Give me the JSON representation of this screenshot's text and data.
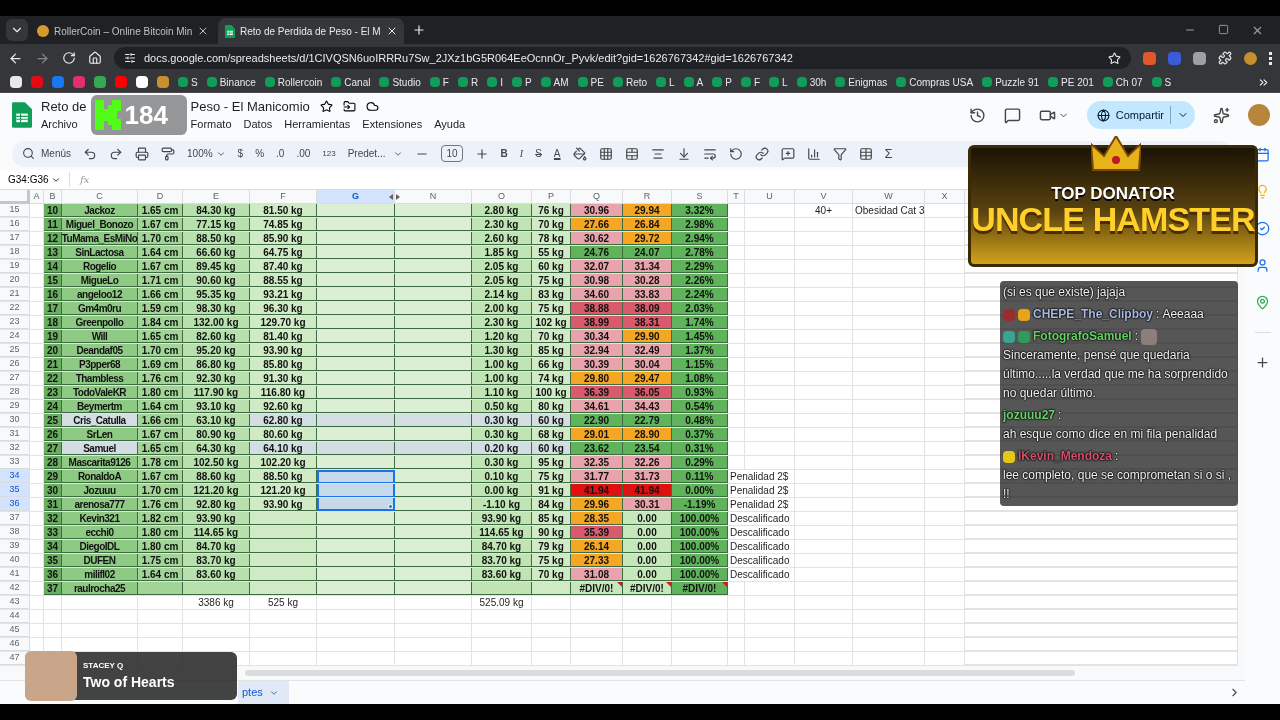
{
  "browser": {
    "tabs": [
      {
        "title": "RollerCoin – Online Bitcoin Min",
        "selected": false
      },
      {
        "title": "Reto de Perdida de Peso - El M",
        "selected": true
      }
    ],
    "url": "docs.google.com/spreadsheets/d/1CIVQSN6uoIRRRu7Sw_2JXz1bG5R064EeOcnnOr_Pyvk/edit?gid=1626767342#gid=1626767342",
    "bookmarks": [
      "S",
      "Binance",
      "Rollercoin",
      "Canal",
      "Studio",
      "F",
      "R",
      "I",
      "P",
      "AM",
      "PE",
      "Reto",
      "L",
      "A",
      "P",
      "F",
      "L",
      "30h",
      "Enigmas",
      "Compras USA",
      "Puzzle 91",
      "PE 201",
      "Ch 07",
      "S"
    ]
  },
  "sheets": {
    "title_parts": [
      "Reto de",
      "Peso - El Manicomio"
    ],
    "menu_left": [
      "Archivo"
    ],
    "menu": [
      "Formato",
      "Datos",
      "Herramientas",
      "Extensiones",
      "Ayuda"
    ],
    "share": "Compartir",
    "toolbar": {
      "search": "Menús",
      "zoom": "100%",
      "currency": "$",
      "percent": "%",
      "dec_less": ".0",
      "dec_more": ".00",
      "number_format": "123",
      "font": "Predet...",
      "font_size": "10",
      "bold": "B",
      "italic": "I",
      "strike": "S",
      "text_color": "A",
      "functions": "Σ"
    },
    "name_box": "G34:G36",
    "fx": "fx",
    "columns": [
      {
        "label": "A",
        "selected": false
      },
      {
        "label": "B",
        "selected": false
      },
      {
        "label": "C",
        "selected": false
      },
      {
        "label": "D",
        "selected": false
      },
      {
        "label": "E",
        "selected": false
      },
      {
        "label": "F",
        "selected": false
      },
      {
        "label": "G",
        "selected": true
      },
      {
        "label": "N",
        "selected": false
      },
      {
        "label": "O",
        "selected": false
      },
      {
        "label": "P",
        "selected": false
      },
      {
        "label": "Q",
        "selected": false
      },
      {
        "label": "R",
        "selected": false
      },
      {
        "label": "S",
        "selected": false
      },
      {
        "label": "T",
        "selected": false
      },
      {
        "label": "U",
        "selected": false
      },
      {
        "label": "V",
        "selected": false
      },
      {
        "label": "W",
        "selected": false
      },
      {
        "label": "X",
        "selected": false
      }
    ],
    "rows": [
      {
        "num": "15",
        "kind": "entry",
        "selected": false,
        "highlighted": false,
        "cells": {
          "B": "10",
          "C": "Jackoz",
          "D": "1.65 cm",
          "E": "84.30 kg",
          "F": "81.50 kg",
          "O": "2.80 kg",
          "P": "76 kg",
          "Q": {
            "text": "30.96",
            "color": "#e8a3ad"
          },
          "R": {
            "text": "29.94",
            "color": "#f5a623"
          },
          "S": {
            "text": "3.32%",
            "color": "#5fb35a"
          },
          "V": "40+",
          "W": "Obesidad Cat 3"
        }
      },
      {
        "num": "16",
        "kind": "entry",
        "selected": false,
        "highlighted": false,
        "cells": {
          "B": "11",
          "C": "Miguel_Bonozo",
          "D": "1.67 cm",
          "E": "77.15 kg",
          "F": "74.85 kg",
          "O": "2.30 kg",
          "P": "70 kg",
          "Q": {
            "text": "27.66",
            "color": "#f5a623"
          },
          "R": {
            "text": "26.84",
            "color": "#f5a623"
          },
          "S": {
            "text": "2.98%",
            "color": "#5fb35a"
          }
        }
      },
      {
        "num": "17",
        "kind": "entry",
        "selected": false,
        "highlighted": false,
        "cells": {
          "B": "12",
          "C": "TuMama_EsMiNo",
          "D": "1.70 cm",
          "E": "88.50 kg",
          "F": "85.90 kg",
          "O": "2.60 kg",
          "P": "78 kg",
          "Q": {
            "text": "30.62",
            "color": "#e8a3ad"
          },
          "R": {
            "text": "29.72",
            "color": "#f5a623"
          },
          "S": {
            "text": "2.94%",
            "color": "#5fb35a"
          }
        }
      },
      {
        "num": "18",
        "kind": "entry",
        "selected": false,
        "highlighted": false,
        "cells": {
          "B": "13",
          "C": "SinLactosa",
          "D": "1.64 cm",
          "E": "66.60 kg",
          "F": "64.75 kg",
          "O": "1.85 kg",
          "P": "55 kg",
          "Q": {
            "text": "24.76",
            "color": "#5fb35a"
          },
          "R": {
            "text": "24.07",
            "color": "#5fb35a"
          },
          "S": {
            "text": "2.78%",
            "color": "#5fb35a"
          }
        }
      },
      {
        "num": "19",
        "kind": "entry",
        "selected": false,
        "highlighted": false,
        "cells": {
          "B": "14",
          "C": "Rogelio",
          "D": "1.67 cm",
          "E": "89.45 kg",
          "F": "87.40 kg",
          "O": "2.05 kg",
          "P": "60 kg",
          "Q": {
            "text": "32.07",
            "color": "#e8a3ad"
          },
          "R": {
            "text": "31.34",
            "color": "#e8a3ad"
          },
          "S": {
            "text": "2.29%",
            "color": "#5fb35a"
          }
        }
      },
      {
        "num": "20",
        "kind": "entry",
        "selected": false,
        "highlighted": false,
        "cells": {
          "B": "15",
          "C": "MigueLo",
          "D": "1.71 cm",
          "E": "90.60 kg",
          "F": "88.55 kg",
          "O": "2.05 kg",
          "P": "75 kg",
          "Q": {
            "text": "30.98",
            "color": "#e8a3ad"
          },
          "R": {
            "text": "30.28",
            "color": "#e8a3ad"
          },
          "S": {
            "text": "2.26%",
            "color": "#5fb35a"
          }
        }
      },
      {
        "num": "21",
        "kind": "entry",
        "selected": false,
        "highlighted": false,
        "cells": {
          "B": "16",
          "C": "angeloo12",
          "D": "1.66 cm",
          "E": "95.35 kg",
          "F": "93.21 kg",
          "O": "2.14 kg",
          "P": "83 kg",
          "Q": {
            "text": "34.60",
            "color": "#e8a3ad"
          },
          "R": {
            "text": "33.83",
            "color": "#e8a3ad"
          },
          "S": {
            "text": "2.24%",
            "color": "#5fb35a"
          }
        }
      },
      {
        "num": "22",
        "kind": "entry",
        "selected": false,
        "highlighted": false,
        "cells": {
          "B": "17",
          "C": "Gm4m0ru",
          "D": "1.59 cm",
          "E": "98.30 kg",
          "F": "96.30 kg",
          "O": "2.00 kg",
          "P": "75 kg",
          "Q": {
            "text": "38.88",
            "color": "#d85a6c"
          },
          "R": {
            "text": "38.09",
            "color": "#d85a6c"
          },
          "S": {
            "text": "2.03%",
            "color": "#5fb35a"
          }
        }
      },
      {
        "num": "23",
        "kind": "entry",
        "selected": false,
        "highlighted": false,
        "cells": {
          "B": "18",
          "C": "Greenpollo",
          "D": "1.84 cm",
          "E": "132.00 kg",
          "F": "129.70 kg",
          "O": "2.30 kg",
          "P": "102 kg",
          "Q": {
            "text": "38.99",
            "color": "#d85a6c"
          },
          "R": {
            "text": "38.31",
            "color": "#d85a6c"
          },
          "S": {
            "text": "1.74%",
            "color": "#5fb35a"
          }
        }
      },
      {
        "num": "24",
        "kind": "entry",
        "selected": false,
        "highlighted": false,
        "cells": {
          "B": "19",
          "C": "Will",
          "D": "1.65 cm",
          "E": "82.60 kg",
          "F": "81.40 kg",
          "O": "1.20 kg",
          "P": "70 kg",
          "Q": {
            "text": "30.34",
            "color": "#e8a3ad"
          },
          "R": {
            "text": "29.90",
            "color": "#f5a623"
          },
          "S": {
            "text": "1.45%",
            "color": "#5fb35a"
          }
        }
      },
      {
        "num": "25",
        "kind": "entry",
        "selected": false,
        "highlighted": false,
        "cells": {
          "B": "20",
          "C": "Deandaf05",
          "D": "1.70 cm",
          "E": "95.20 kg",
          "F": "93.90 kg",
          "O": "1.30 kg",
          "P": "85 kg",
          "Q": {
            "text": "32.94",
            "color": "#e8a3ad"
          },
          "R": {
            "text": "32.49",
            "color": "#e8a3ad"
          },
          "S": {
            "text": "1.37%",
            "color": "#5fb35a"
          }
        }
      },
      {
        "num": "26",
        "kind": "entry",
        "selected": false,
        "highlighted": false,
        "cells": {
          "B": "21",
          "C": "P3pper68",
          "D": "1.69 cm",
          "E": "86.80 kg",
          "F": "85.80 kg",
          "O": "1.00 kg",
          "P": "66 kg",
          "Q": {
            "text": "30.39",
            "color": "#e8a3ad"
          },
          "R": {
            "text": "30.04",
            "color": "#e8a3ad"
          },
          "S": {
            "text": "1.15%",
            "color": "#5fb35a"
          }
        }
      },
      {
        "num": "27",
        "kind": "entry",
        "selected": false,
        "highlighted": false,
        "cells": {
          "B": "22",
          "C": "Thambless",
          "D": "1.76 cm",
          "E": "92.30 kg",
          "F": "91.30 kg",
          "O": "1.00 kg",
          "P": "74 kg",
          "Q": {
            "text": "29.80",
            "color": "#f5a623"
          },
          "R": {
            "text": "29.47",
            "color": "#f5a623"
          },
          "S": {
            "text": "1.08%",
            "color": "#5fb35a"
          }
        }
      },
      {
        "num": "28",
        "kind": "entry",
        "selected": false,
        "highlighted": false,
        "cells": {
          "B": "23",
          "C": "TodoValeKR",
          "D": "1.80 cm",
          "E": "117.90 kg",
          "F": "116.80 kg",
          "O": "1.10 kg",
          "P": "100 kg",
          "Q": {
            "text": "36.39",
            "color": "#d85a6c"
          },
          "R": {
            "text": "36.05",
            "color": "#d85a6c"
          },
          "S": {
            "text": "0.93%",
            "color": "#5fb35a"
          }
        }
      },
      {
        "num": "29",
        "kind": "entry",
        "selected": false,
        "highlighted": false,
        "cells": {
          "B": "24",
          "C": "Beymertm",
          "D": "1.64 cm",
          "E": "93.10 kg",
          "F": "92.60 kg",
          "O": "0.50 kg",
          "P": "80 kg",
          "Q": {
            "text": "34.61",
            "color": "#e8a3ad"
          },
          "R": {
            "text": "34.43",
            "color": "#e8a3ad"
          },
          "S": {
            "text": "0.54%",
            "color": "#5fb35a"
          }
        }
      },
      {
        "num": "30",
        "kind": "entry",
        "selected": false,
        "highlighted": true,
        "cells": {
          "B": "25",
          "C": "Cris_Catulla",
          "D": "1.66 cm",
          "E": "63.10 kg",
          "F": "62.80 kg",
          "O": "0.30 kg",
          "P": "60 kg",
          "Q": {
            "text": "22.90",
            "color": "#5fb35a"
          },
          "R": {
            "text": "22.79",
            "color": "#5fb35a"
          },
          "S": {
            "text": "0.48%",
            "color": "#5fb35a"
          }
        }
      },
      {
        "num": "31",
        "kind": "entry",
        "selected": false,
        "highlighted": false,
        "cells": {
          "B": "26",
          "C": "SrLen",
          "D": "1.67 cm",
          "E": "80.90 kg",
          "F": "80.60 kg",
          "O": "0.30 kg",
          "P": "68 kg",
          "Q": {
            "text": "29.01",
            "color": "#f5a623"
          },
          "R": {
            "text": "28.90",
            "color": "#f5a623"
          },
          "S": {
            "text": "0.37%",
            "color": "#5fb35a"
          }
        }
      },
      {
        "num": "32",
        "kind": "entry",
        "selected": false,
        "highlighted": true,
        "cells": {
          "B": "27",
          "C": "Samuel",
          "D": "1.65 cm",
          "E": "64.30 kg",
          "F": "64.10 kg",
          "O": "0.20 kg",
          "P": "60 kg",
          "Q": {
            "text": "23.62",
            "color": "#5fb35a"
          },
          "R": {
            "text": "23.54",
            "color": "#5fb35a"
          },
          "S": {
            "text": "0.31%",
            "color": "#5fb35a"
          }
        }
      },
      {
        "num": "33",
        "kind": "entry",
        "selected": false,
        "highlighted": false,
        "cells": {
          "B": "28",
          "C": "Mascarita9126",
          "D": "1.78 cm",
          "E": "102.50 kg",
          "F": "102.20 kg",
          "O": "0.30 kg",
          "P": "95 kg",
          "Q": {
            "text": "32.35",
            "color": "#e8a3ad"
          },
          "R": {
            "text": "32.26",
            "color": "#e8a3ad"
          },
          "S": {
            "text": "0.29%",
            "color": "#5fb35a"
          }
        }
      },
      {
        "num": "34",
        "kind": "entry",
        "selected": true,
        "highlighted": false,
        "cells": {
          "B": "29",
          "C": "RonaldoA",
          "D": "1.67 cm",
          "E": "88.60 kg",
          "F": "88.50 kg",
          "O": "0.10 kg",
          "P": "75 kg",
          "Q": {
            "text": "31.77",
            "color": "#e8a3ad"
          },
          "R": {
            "text": "31.73",
            "color": "#e8a3ad"
          },
          "S": {
            "text": "0.11%",
            "color": "#5fb35a"
          },
          "T": "Penalidad 2$"
        }
      },
      {
        "num": "35",
        "kind": "entry",
        "selected": true,
        "highlighted": false,
        "cells": {
          "B": "30",
          "C": "Jozuuu",
          "D": "1.70 cm",
          "E": "121.20 kg",
          "F": "121.20 kg",
          "O": "0.00 kg",
          "P": "91 kg",
          "Q": {
            "text": "41.94",
            "color": "#e01010"
          },
          "R": {
            "text": "41.94",
            "color": "#e01010"
          },
          "S": {
            "text": "0.00%",
            "color": "#5fb35a"
          },
          "T": "Penalidad 2$"
        }
      },
      {
        "num": "36",
        "kind": "entry",
        "selected": true,
        "highlighted": false,
        "cells": {
          "B": "31",
          "C": "arenosa777",
          "D": "1.76 cm",
          "E": "92.80 kg",
          "F": "93.90 kg",
          "O": "-1.10 kg",
          "P": "84 kg",
          "Q": {
            "text": "29.96",
            "color": "#f5a623"
          },
          "R": {
            "text": "30.31",
            "color": "#e8a3ad"
          },
          "S": {
            "text": "-1.19%",
            "color": "#5fb35a"
          },
          "T": "Penalidad 2$"
        }
      },
      {
        "num": "37",
        "kind": "entry",
        "selected": false,
        "highlighted": false,
        "cells": {
          "B": "32",
          "C": "Kevin321",
          "D": "1.82 cm",
          "E": "93.90 kg",
          "O": "93.90 kg",
          "P": "85 kg",
          "Q": {
            "text": "28.35",
            "color": "#f5a623"
          },
          "R": {
            "text": "0.00",
            "color": "#c6e6bc"
          },
          "S": {
            "text": "100.00%",
            "color": "#5fb35a"
          },
          "T": "Descalificado"
        }
      },
      {
        "num": "38",
        "kind": "entry",
        "selected": false,
        "highlighted": false,
        "cells": {
          "B": "33",
          "C": "ecchi0",
          "D": "1.80 cm",
          "E": "114.65 kg",
          "O": "114.65 kg",
          "P": "90 kg",
          "Q": {
            "text": "35.39",
            "color": "#d85a6c"
          },
          "R": {
            "text": "0.00",
            "color": "#c6e6bc"
          },
          "S": {
            "text": "100.00%",
            "color": "#5fb35a"
          },
          "T": "Descalificado"
        }
      },
      {
        "num": "39",
        "kind": "entry",
        "selected": false,
        "highlighted": false,
        "cells": {
          "B": "34",
          "C": "DiegoIDL",
          "D": "1.80 cm",
          "E": "84.70 kg",
          "O": "84.70 kg",
          "P": "79 kg",
          "Q": {
            "text": "26.14",
            "color": "#f5a623"
          },
          "R": {
            "text": "0.00",
            "color": "#c6e6bc"
          },
          "S": {
            "text": "100.00%",
            "color": "#5fb35a"
          },
          "T": "Descalificado"
        }
      },
      {
        "num": "40",
        "kind": "entry",
        "selected": false,
        "highlighted": false,
        "cells": {
          "B": "35",
          "C": "DUFEN",
          "D": "1.75 cm",
          "E": "83.70 kg",
          "O": "83.70 kg",
          "P": "75 kg",
          "Q": {
            "text": "27.33",
            "color": "#f5a623"
          },
          "R": {
            "text": "0.00",
            "color": "#c6e6bc"
          },
          "S": {
            "text": "100.00%",
            "color": "#5fb35a"
          },
          "T": "Descalificado"
        }
      },
      {
        "num": "41",
        "kind": "entry",
        "selected": false,
        "highlighted": false,
        "cells": {
          "B": "36",
          "C": "milifl02",
          "D": "1.64 cm",
          "E": "83.60 kg",
          "O": "83.60 kg",
          "P": "70 kg",
          "Q": {
            "text": "31.08",
            "color": "#e8a3ad"
          },
          "R": {
            "text": "0.00",
            "color": "#c6e6bc"
          },
          "S": {
            "text": "100.00%",
            "color": "#5fb35a"
          },
          "T": "Descalificado"
        }
      },
      {
        "num": "42",
        "kind": "entry",
        "selected": false,
        "highlighted": false,
        "cells": {
          "B": "37",
          "C": "raulrocha25",
          "Q": {
            "text": "#DIV/0!",
            "color": "#c6e6bc",
            "error": true
          },
          "R": {
            "text": "#DIV/0!",
            "color": "#c6e6bc",
            "error": true
          },
          "S": {
            "text": "#DIV/0!",
            "color": "#5fb35a",
            "error": true
          }
        }
      },
      {
        "num": "43",
        "kind": "total",
        "selected": false,
        "highlighted": false,
        "cells": {
          "E": "3386 kg",
          "F": "525 kg",
          "O": "525.09 kg"
        }
      },
      {
        "num": "44",
        "kind": "blank",
        "selected": false,
        "highlighted": false,
        "cells": {}
      },
      {
        "num": "45",
        "kind": "blank",
        "selected": false,
        "highlighted": false,
        "cells": {}
      },
      {
        "num": "46",
        "kind": "blank",
        "selected": false,
        "highlighted": false,
        "cells": {}
      },
      {
        "num": "47",
        "kind": "blank",
        "selected": false,
        "highlighted": false,
        "cells": {}
      }
    ],
    "sheet_tab": "ptes"
  },
  "overlays": {
    "counter": "184",
    "donator": {
      "line1": "TOP DONATOR",
      "line2": "UNCLE HAMSTER"
    },
    "chat": [
      {
        "kind": "continuation",
        "text": "(si es que existe) jajaja"
      },
      {
        "kind": "message",
        "user": "CHEPE_The_Clipboy",
        "color": "#a8b9e2",
        "badges": [
          {
            "color": "#9b2c2c"
          },
          {
            "color": "#e8a317"
          }
        ],
        "separator": ":",
        "emote": false,
        "text": "Aeeaaa"
      },
      {
        "kind": "message",
        "user": "FotografoSamuel",
        "color": "#62d262",
        "badges": [
          {
            "color": "#3aa58e"
          },
          {
            "color": "#2f9a5a"
          }
        ],
        "separator": ":",
        "emote": true,
        "text": "Sinceramente, pensé que quedaria último.....la verdad que me ha sorprendido no quedar último."
      },
      {
        "kind": "message",
        "user": "jozuuu27",
        "color": "#6ad06a",
        "separator": ":",
        "emote": false,
        "text": "ah esque como dice en mi fila penalidad"
      },
      {
        "kind": "message",
        "user": "lKevin_Mendoza",
        "color": "#d4506c",
        "badges": [
          {
            "color": "#e8c617"
          }
        ],
        "separator": ":",
        "emote": false,
        "text": "lee completo, que se comprometan si o si , !!"
      }
    ],
    "now_playing": {
      "artist": "STACEY Q",
      "title": "Two of Hearts"
    }
  }
}
